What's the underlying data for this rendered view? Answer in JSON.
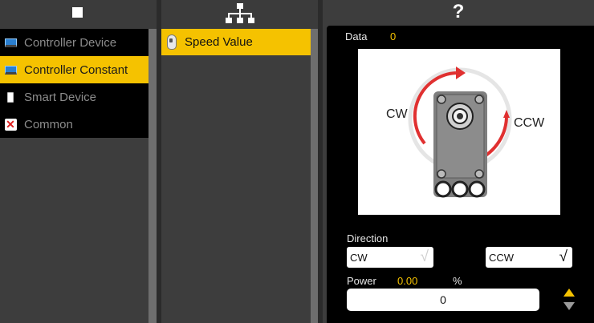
{
  "categories_panel": {
    "header_icon": "square-icon",
    "items": [
      {
        "label": "Controller Device",
        "icon": "monitor-icon",
        "selected": false
      },
      {
        "label": "Controller Constant",
        "icon": "monitor-icon",
        "selected": true
      },
      {
        "label": "Smart Device",
        "icon": "phone-icon",
        "selected": false
      },
      {
        "label": "Common",
        "icon": "x-icon",
        "selected": false
      }
    ]
  },
  "blocks_panel": {
    "header_icon": "hierarchy-icon",
    "items": [
      {
        "label": "Speed Value",
        "icon": "knob-icon",
        "selected": true
      }
    ]
  },
  "properties_panel": {
    "header_icon": "?",
    "data_label": "Data",
    "data_value": "0",
    "diagram": {
      "cw_label": "CW",
      "ccw_label": "CCW"
    },
    "direction_label": "Direction",
    "direction_options": [
      {
        "label": "CW",
        "checked": false
      },
      {
        "label": "CCW",
        "checked": true
      }
    ],
    "check_glyph": "√",
    "power_label": "Power",
    "power_value": "0.00",
    "power_unit": "%",
    "power_input_value": "0",
    "colors": {
      "accent": "#f5c200",
      "arrow": "#e03030"
    }
  }
}
